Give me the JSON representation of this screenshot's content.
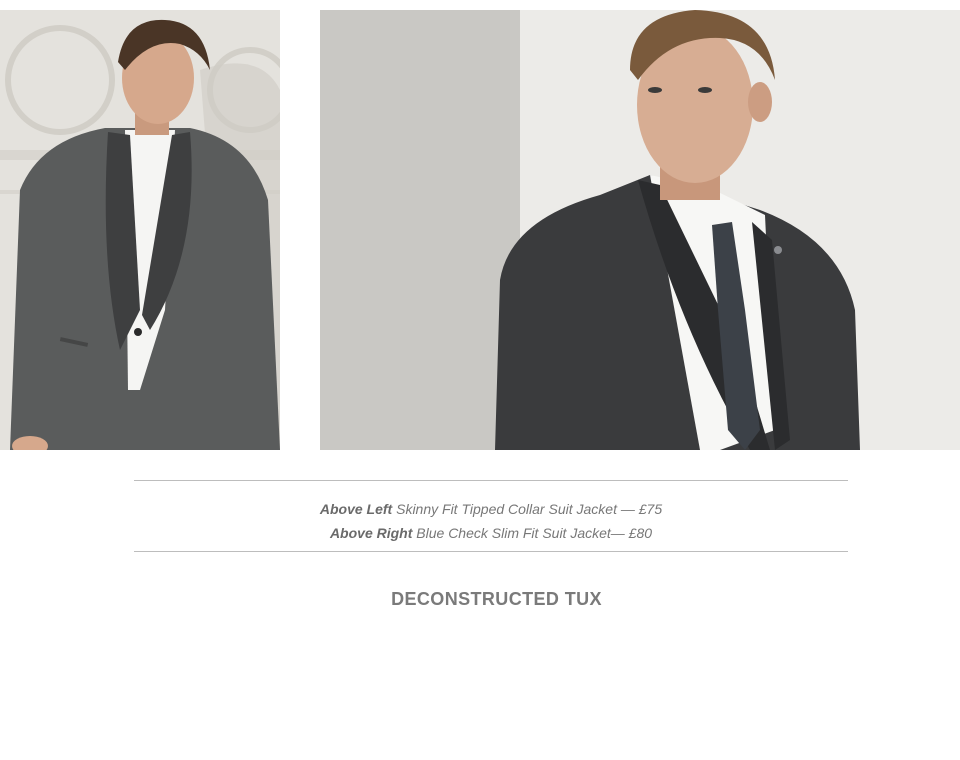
{
  "images": {
    "left": {
      "name": "tipped-collar-jacket-photo",
      "colors": {
        "background": "#e4e2dd",
        "jacket": "#5a5c5c",
        "lapel": "#3e3f40",
        "shirt": "#f5f5f3",
        "skin": "#d6a88c",
        "hair": "#4a3526"
      }
    },
    "right": {
      "name": "blue-check-jacket-photo",
      "colors": {
        "background_left": "#c9c8c4",
        "background_right": "#ecebe8",
        "jacket": "#3a3b3d",
        "lapel": "#2b2c2e",
        "shirt": "#f7f7f5",
        "tie": "#3c4148",
        "skin": "#d7ad93",
        "hair": "#7a5a3c"
      }
    }
  },
  "caption": {
    "line1_label": "Above Left",
    "line1_text": " Skinny Fit Tipped Collar Suit Jacket — £75",
    "line2_label": "Above Right",
    "line2_text": " Blue Check Slim Fit Suit Jacket— £80"
  },
  "section": {
    "heading": "DECONSTRUCTED TUX"
  }
}
